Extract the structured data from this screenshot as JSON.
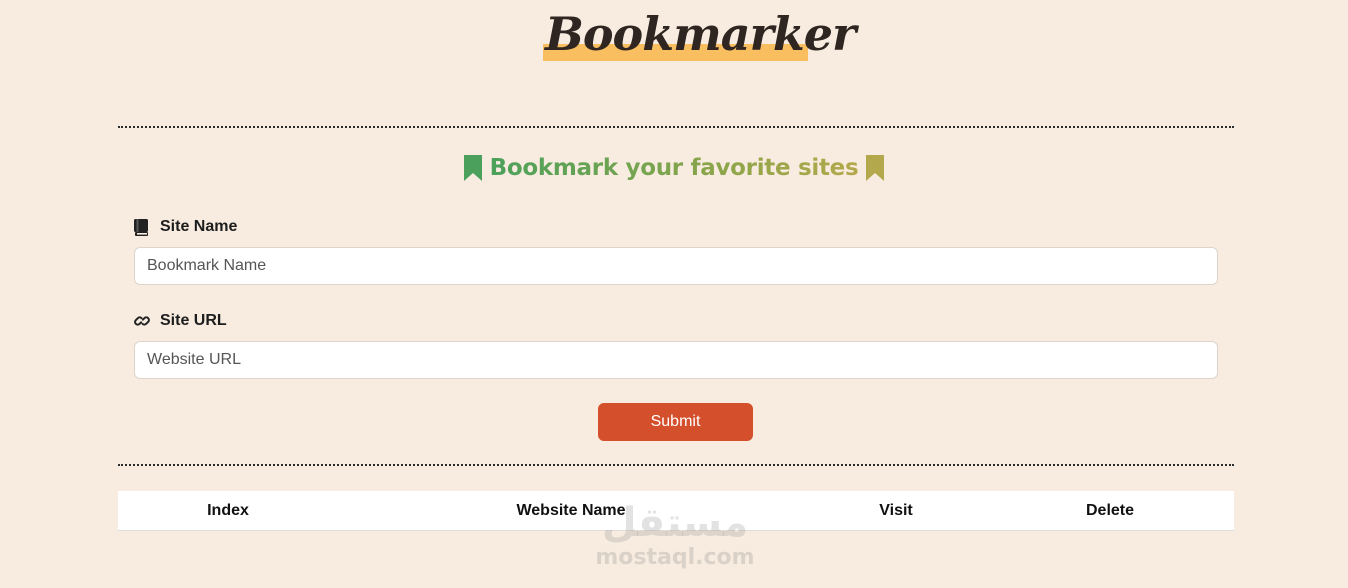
{
  "app": {
    "logo_text": "Bookmarker",
    "heading": "Bookmark your favorite sites"
  },
  "form": {
    "site_name_label": "Site Name",
    "site_name_placeholder": "Bookmark Name",
    "site_name_value": "",
    "site_url_label": "Site URL",
    "site_url_placeholder": "Website URL",
    "site_url_value": "",
    "submit_label": "Submit"
  },
  "table": {
    "columns": [
      "Index",
      "Website Name",
      "Visit",
      "Delete"
    ],
    "rows": []
  },
  "watermark": {
    "arabic": "مستقل",
    "latin": "mostaql.com"
  },
  "colors": {
    "background": "#f8ece0",
    "logo_highlight": "#f9be5f",
    "heading_green": "#4ba15b",
    "heading_olive": "#b3a84b",
    "submit_button": "#d44f2b"
  },
  "icons": {
    "heading_left": "bookmark-icon",
    "heading_right": "bookmark-icon",
    "site_name": "book-icon",
    "site_url": "link-icon"
  }
}
